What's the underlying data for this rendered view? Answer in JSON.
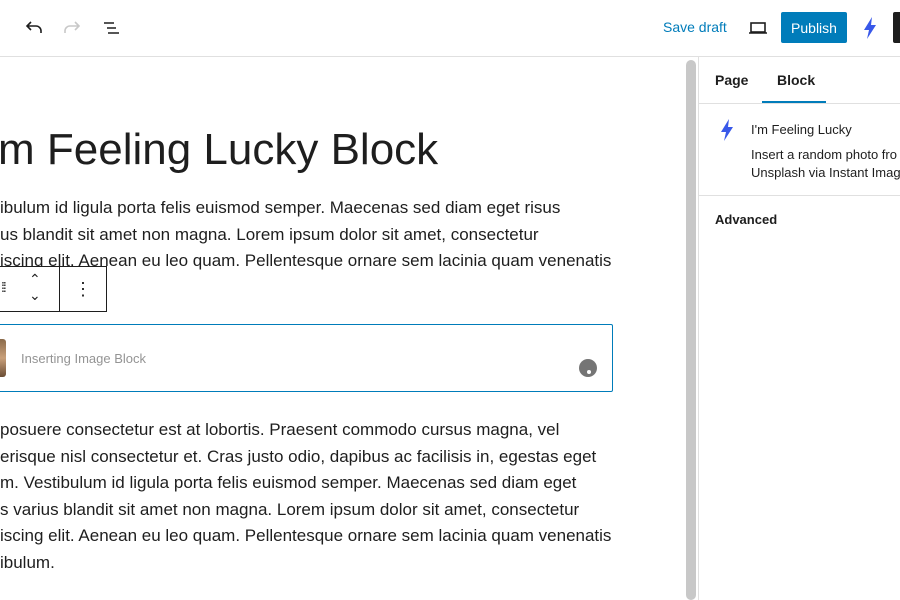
{
  "header": {
    "save_draft": "Save draft",
    "publish": "Publish"
  },
  "editor": {
    "title": "m Feeling Lucky Block",
    "para1": [
      "ibulum id ligula porta felis euismod semper. Maecenas sed diam eget risus",
      "us blandit sit amet non magna. Lorem ipsum dolor sit amet, consectetur",
      "iscing elit. Aenean eu leo quam. Pellentesque ornare sem lacinia quam venenatis"
    ],
    "image_block_status": "Inserting Image Block",
    "para2": [
      "posuere consectetur est at lobortis. Praesent commodo cursus magna, vel",
      "erisque nisl consectetur et. Cras justo odio, dapibus ac facilisis in, egestas eget",
      "m. Vestibulum id ligula porta felis euismod semper. Maecenas sed diam eget",
      "s varius blandit sit amet non magna. Lorem ipsum dolor sit amet, consectetur",
      "iscing elit. Aenean eu leo quam. Pellentesque ornare sem lacinia quam venenatis",
      "ibulum."
    ]
  },
  "sidebar": {
    "tabs": [
      "Page",
      "Block"
    ],
    "active_tab": "Block",
    "block_name": "I'm Feeling Lucky",
    "block_description": [
      "Insert a random photo fro",
      "Unsplash via Instant Imag"
    ],
    "advanced": "Advanced"
  },
  "colors": {
    "accent": "#007cba",
    "bolt": "#3858e9"
  }
}
